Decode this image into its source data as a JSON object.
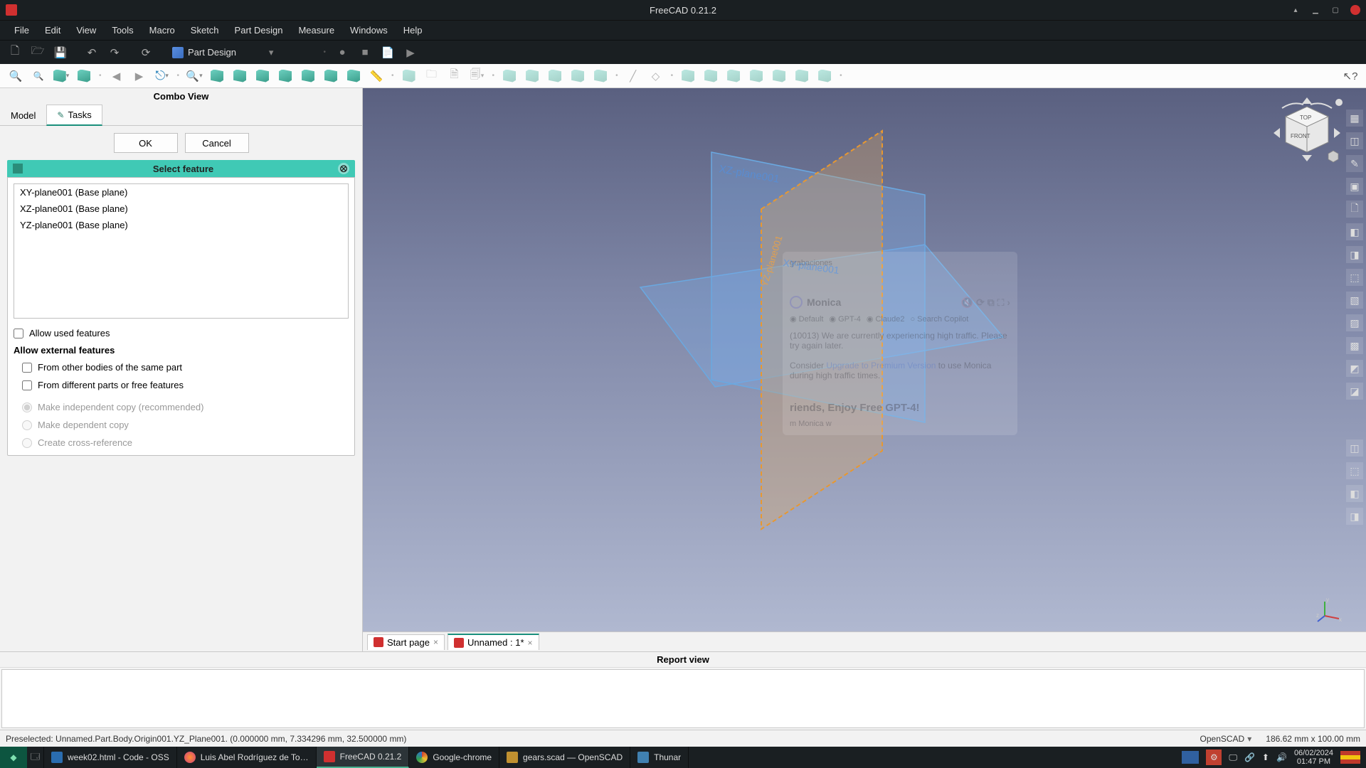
{
  "app": {
    "title": "FreeCAD 0.21.2"
  },
  "menubar": [
    "File",
    "Edit",
    "View",
    "Tools",
    "Macro",
    "Sketch",
    "Part Design",
    "Measure",
    "Windows",
    "Help"
  ],
  "toolbar": {
    "workbench": "Part Design"
  },
  "combo": {
    "title": "Combo View",
    "tabs": {
      "model": "Model",
      "tasks": "Tasks"
    },
    "ok": "OK",
    "cancel": "Cancel",
    "task_title": "Select feature",
    "features": [
      "XY-plane001 (Base plane)",
      "XZ-plane001 (Base plane)",
      "YZ-plane001 (Base plane)"
    ],
    "allow_used": "Allow used features",
    "allow_external": "Allow external features",
    "from_other_bodies": "From other bodies of the same part",
    "from_different_parts": "From different parts or free features",
    "indep_copy": "Make independent copy (recommended)",
    "dep_copy": "Make dependent copy",
    "cross_ref": "Create cross-reference"
  },
  "viewport_labels": {
    "xz": "XZ-plane001",
    "xy": "XY-plane001",
    "yz": "YZ-plane001",
    "navcube_top": "TOP",
    "navcube_front": "FRONT"
  },
  "monica": {
    "header": "Monica",
    "chips": [
      "Default",
      "GPT-4",
      "Claude2",
      "Search Copilot"
    ],
    "msg1": "(10013) We are currently experiencing high traffic. Please try again later.",
    "msg2a": "Consider ",
    "msg2b": "Upgrade to Premium Version",
    "msg2c": " to use Monica during high traffic times.",
    "banner": "riends, Enjoy Free GPT-4!",
    "sub": "m Monica w",
    "grab": "grabaciones"
  },
  "doc_tabs": {
    "start": "Start page",
    "unnamed": "Unnamed : 1*"
  },
  "report": {
    "title": "Report view"
  },
  "status": {
    "preselected": "Preselected: Unnamed.Part.Body.Origin001.YZ_Plane001. (0.000000 mm, 7.334296 mm, 32.500000 mm)",
    "engine": "OpenSCAD",
    "dims": "186.62 mm x 100.00 mm"
  },
  "taskbar": {
    "items": [
      "week02.html - Code - OSS",
      "Luis Abel Rodríguez de To…",
      "FreeCAD 0.21.2",
      "Google-chrome",
      "gears.scad — OpenSCAD",
      "Thunar"
    ],
    "date": "06/02/2024",
    "time": "01:47 PM"
  }
}
